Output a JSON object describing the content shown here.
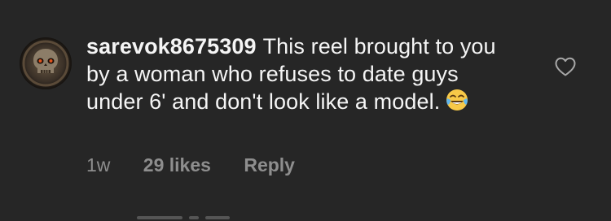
{
  "comment": {
    "username": "sarevok8675309",
    "text": "This reel brought to you by a woman who refuses to date guys under 6' and don't look like a model.",
    "emoji": "face-with-tears-of-joy",
    "time": "1w",
    "likes": "29 likes",
    "reply_label": "Reply",
    "avatar_icon": "skull-avatar",
    "like_icon": "heart-outline-icon"
  },
  "colors": {
    "background": "#262626",
    "text": "#f5f5f5",
    "meta": "#8e8e8e"
  }
}
